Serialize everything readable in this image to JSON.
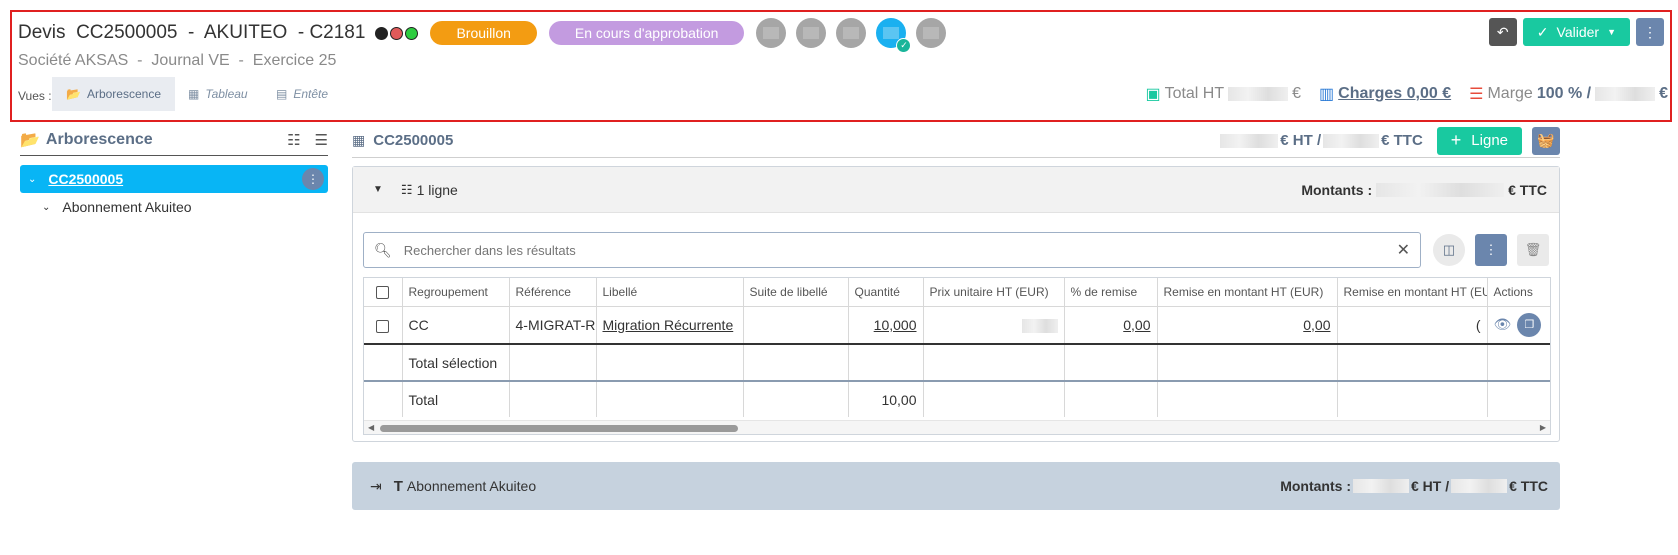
{
  "header": {
    "title": "Devis  CC2500005  -  AKUITEO  - C2181",
    "subtitle": "Société AKSAS  -  Journal VE  -  Exercice 25",
    "status_dots": [
      "#222222",
      "#e05a5a",
      "#2ecc40"
    ],
    "status_pill_1": "Brouillon",
    "status_pill_2": "En cours d'approbation",
    "back_icon": "undo-icon",
    "valider_label": "Valider",
    "views_label": "Vues :",
    "views": [
      {
        "label": "Arborescence",
        "icon": "folder-open-icon",
        "active": true
      },
      {
        "label": "Tableau",
        "icon": "table-icon",
        "active": false
      },
      {
        "label": "Entête",
        "icon": "file-header-icon",
        "active": false
      }
    ],
    "total_ht_label": "Total HT",
    "total_ht_currency": "€",
    "charges_label": "Charges 0,00 €",
    "marge_label": "Marge",
    "marge_value": "100 % /",
    "marge_currency": "€"
  },
  "sidebar": {
    "title": "Arborescence",
    "tree": {
      "root": "CC2500005",
      "child": "Abonnement Akuiteo"
    }
  },
  "main": {
    "title": "CC2500005",
    "amount_ht_suffix": "€ HT /",
    "amount_ttc_suffix": "€ TTC",
    "add_line_label": "Ligne",
    "group": {
      "lines_label": "1 ligne",
      "amounts_label": "Montants :",
      "amounts_suffix": "€ TTC",
      "search_placeholder": "Rechercher dans les résultats",
      "columns": [
        "Regroupement",
        "Référence",
        "Libellé",
        "Suite de libellé",
        "Quantité",
        "Prix unitaire HT (EUR)",
        "% de remise",
        "Remise en montant HT (EUR)",
        "Remise en montant HT (EUR",
        "Actions"
      ],
      "rows": [
        {
          "regroupement": "CC",
          "reference": "4-MIGRAT-R",
          "libelle": "Migration Récurrente",
          "suite": "",
          "quantite": "10,000",
          "prix": "",
          "remise_pct": "0,00",
          "remise_montant": "0,00",
          "remise_montant2": "("
        }
      ],
      "total_selection_label": "Total sélection",
      "total_label": "Total",
      "total_quantite": "10,00"
    },
    "group2": {
      "title": "Abonnement Akuiteo",
      "amounts_label": "Montants :",
      "amounts_ht_suffix": "€ HT /",
      "amounts_ttc_suffix": "€ TTC"
    }
  }
}
